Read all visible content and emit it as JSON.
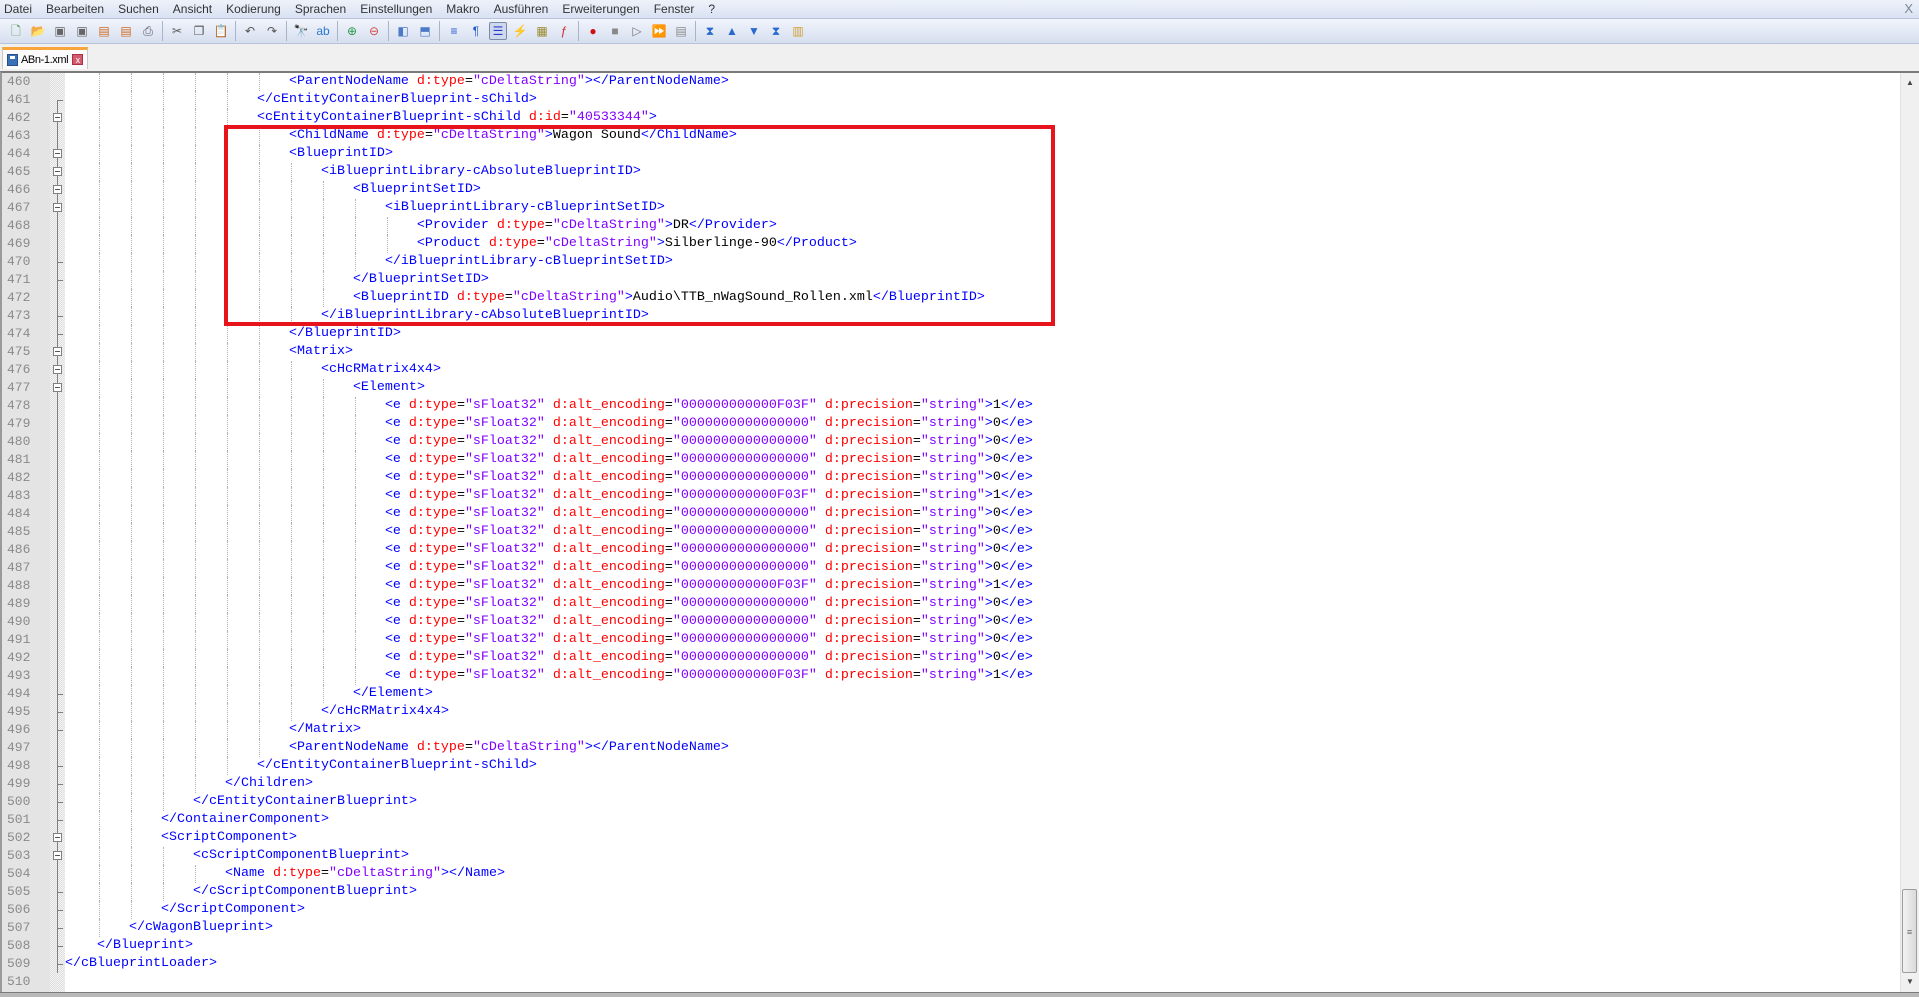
{
  "menu": [
    "Datei",
    "Bearbeiten",
    "Suchen",
    "Ansicht",
    "Kodierung",
    "Sprachen",
    "Einstellungen",
    "Makro",
    "Ausführen",
    "Erweiterungen",
    "Fenster",
    "?"
  ],
  "window_close": "X",
  "toolbar": [
    {
      "icon": "new-file-icon",
      "glyph": "🗋",
      "color": "#3a8a3a"
    },
    {
      "icon": "open-file-icon",
      "glyph": "📂",
      "color": "#d9a43a"
    },
    {
      "icon": "save-icon",
      "glyph": "▣",
      "color": "#666"
    },
    {
      "icon": "save-all-icon",
      "glyph": "▣",
      "color": "#666"
    },
    {
      "icon": "close-icon",
      "glyph": "▤",
      "color": "#d2691e"
    },
    {
      "icon": "close-all-icon",
      "glyph": "▤",
      "color": "#d2691e"
    },
    {
      "icon": "print-icon",
      "glyph": "⎙",
      "color": "#556"
    },
    {
      "sep": true
    },
    {
      "icon": "cut-icon",
      "glyph": "✂",
      "color": "#555"
    },
    {
      "icon": "copy-icon",
      "glyph": "❐",
      "color": "#555"
    },
    {
      "icon": "paste-icon",
      "glyph": "📋",
      "color": "#c8a04a"
    },
    {
      "sep": true
    },
    {
      "icon": "undo-icon",
      "glyph": "↶",
      "color": "#555"
    },
    {
      "icon": "redo-icon",
      "glyph": "↷",
      "color": "#555"
    },
    {
      "sep": true
    },
    {
      "icon": "find-icon",
      "glyph": "🔭",
      "color": "#333"
    },
    {
      "icon": "replace-icon",
      "glyph": "ab",
      "color": "#2a7ad0"
    },
    {
      "sep": true
    },
    {
      "icon": "zoom-in-icon",
      "glyph": "⊕",
      "color": "#2a9a4a"
    },
    {
      "icon": "zoom-out-icon",
      "glyph": "⊖",
      "color": "#d04a4a"
    },
    {
      "sep": true
    },
    {
      "icon": "sync-vertical-icon",
      "glyph": "◧",
      "color": "#4a7ac8"
    },
    {
      "icon": "sync-horizontal-icon",
      "glyph": "⬒",
      "color": "#4a7ac8"
    },
    {
      "sep": true
    },
    {
      "icon": "word-wrap-icon",
      "glyph": "≡",
      "color": "#2a5ad0"
    },
    {
      "icon": "show-all-characters-icon",
      "glyph": "¶",
      "color": "#2a5ad0"
    },
    {
      "icon": "indent-guide-icon",
      "glyph": "☰",
      "color": "#2a3ad0",
      "active": true
    },
    {
      "icon": "user-defined-language-icon",
      "glyph": "⚡",
      "color": "#e0a020"
    },
    {
      "icon": "document-map-icon",
      "glyph": "▦",
      "color": "#9a8a2a"
    },
    {
      "icon": "function-list-icon",
      "glyph": "ƒ",
      "color": "#d02a2a"
    },
    {
      "sep": true
    },
    {
      "icon": "record-macro-icon",
      "glyph": "●",
      "color": "#d01010"
    },
    {
      "icon": "stop-recording-icon",
      "glyph": "■",
      "color": "#888"
    },
    {
      "icon": "playback-macro-icon",
      "glyph": "▷",
      "color": "#777"
    },
    {
      "icon": "run-macro-multiple-icon",
      "glyph": "⏩",
      "color": "#3a6ad0"
    },
    {
      "icon": "save-macro-icon",
      "glyph": "▤",
      "color": "#888"
    },
    {
      "sep": true
    },
    {
      "icon": "first-icon",
      "glyph": "⧗",
      "color": "#2a6ad0"
    },
    {
      "icon": "previous-icon",
      "glyph": "▲",
      "color": "#2a6ad0"
    },
    {
      "icon": "next-icon",
      "glyph": "▼",
      "color": "#2a6ad0"
    },
    {
      "icon": "last-icon",
      "glyph": "⧗",
      "color": "#2a6ad0"
    },
    {
      "icon": "plugin-icon",
      "glyph": "▥",
      "color": "#d0a030"
    }
  ],
  "tab": {
    "label": "ABn-1.xml",
    "close": "x"
  },
  "colors": {
    "tag": "#0000ff",
    "attribute": "#ff0000",
    "value": "#8000ff",
    "text": "#000000",
    "highlight_box": "#e8141c",
    "active_tab_accent": "#f8a53b"
  },
  "editor": {
    "lines": [
      {
        "n": "460",
        "text": "                            <ParentNodeName d:type=\"cDeltaString\"></ParentNodeName>"
      },
      {
        "n": "461",
        "text": "                        </cEntityContainerBlueprint-sChild>",
        "fold": "end"
      },
      {
        "n": "462",
        "text": "                        <cEntityContainerBlueprint-sChild d:id=\"40533344\">",
        "fold": "box"
      },
      {
        "n": "463",
        "text": "                            <ChildName d:type=\"cDeltaString\">Wagon Sound</ChildName>"
      },
      {
        "n": "464",
        "text": "                            <BlueprintID>",
        "fold": "box"
      },
      {
        "n": "465",
        "text": "                                <iBlueprintLibrary-cAbsoluteBlueprintID>",
        "fold": "box"
      },
      {
        "n": "466",
        "text": "                                    <BlueprintSetID>",
        "fold": "box"
      },
      {
        "n": "467",
        "text": "                                        <iBlueprintLibrary-cBlueprintSetID>",
        "fold": "box"
      },
      {
        "n": "468",
        "text": "                                            <Provider d:type=\"cDeltaString\">DR</Provider>"
      },
      {
        "n": "469",
        "text": "                                            <Product d:type=\"cDeltaString\">Silberlinge-90</Product>"
      },
      {
        "n": "470",
        "text": "                                        </iBlueprintLibrary-cBlueprintSetID>",
        "fold": "end"
      },
      {
        "n": "471",
        "text": "                                    </BlueprintSetID>",
        "fold": "end"
      },
      {
        "n": "472",
        "text": "                                    <BlueprintID d:type=\"cDeltaString\">Audio\\TTB_nWagSound_Rollen.xml</BlueprintID>"
      },
      {
        "n": "473",
        "text": "                                </iBlueprintLibrary-cAbsoluteBlueprintID>",
        "fold": "end"
      },
      {
        "n": "474",
        "text": "                            </BlueprintID>",
        "fold": "end"
      },
      {
        "n": "475",
        "text": "                            <Matrix>",
        "fold": "box"
      },
      {
        "n": "476",
        "text": "                                <cHcRMatrix4x4>",
        "fold": "box"
      },
      {
        "n": "477",
        "text": "                                    <Element>",
        "fold": "box"
      },
      {
        "n": "478",
        "text": "                                        <e d:type=\"sFloat32\" d:alt_encoding=\"000000000000F03F\" d:precision=\"string\">1</e>"
      },
      {
        "n": "479",
        "text": "                                        <e d:type=\"sFloat32\" d:alt_encoding=\"0000000000000000\" d:precision=\"string\">0</e>"
      },
      {
        "n": "480",
        "text": "                                        <e d:type=\"sFloat32\" d:alt_encoding=\"0000000000000000\" d:precision=\"string\">0</e>"
      },
      {
        "n": "481",
        "text": "                                        <e d:type=\"sFloat32\" d:alt_encoding=\"0000000000000000\" d:precision=\"string\">0</e>"
      },
      {
        "n": "482",
        "text": "                                        <e d:type=\"sFloat32\" d:alt_encoding=\"0000000000000000\" d:precision=\"string\">0</e>"
      },
      {
        "n": "483",
        "text": "                                        <e d:type=\"sFloat32\" d:alt_encoding=\"000000000000F03F\" d:precision=\"string\">1</e>"
      },
      {
        "n": "484",
        "text": "                                        <e d:type=\"sFloat32\" d:alt_encoding=\"0000000000000000\" d:precision=\"string\">0</e>"
      },
      {
        "n": "485",
        "text": "                                        <e d:type=\"sFloat32\" d:alt_encoding=\"0000000000000000\" d:precision=\"string\">0</e>"
      },
      {
        "n": "486",
        "text": "                                        <e d:type=\"sFloat32\" d:alt_encoding=\"0000000000000000\" d:precision=\"string\">0</e>"
      },
      {
        "n": "487",
        "text": "                                        <e d:type=\"sFloat32\" d:alt_encoding=\"0000000000000000\" d:precision=\"string\">0</e>"
      },
      {
        "n": "488",
        "text": "                                        <e d:type=\"sFloat32\" d:alt_encoding=\"000000000000F03F\" d:precision=\"string\">1</e>"
      },
      {
        "n": "489",
        "text": "                                        <e d:type=\"sFloat32\" d:alt_encoding=\"0000000000000000\" d:precision=\"string\">0</e>"
      },
      {
        "n": "490",
        "text": "                                        <e d:type=\"sFloat32\" d:alt_encoding=\"0000000000000000\" d:precision=\"string\">0</e>"
      },
      {
        "n": "491",
        "text": "                                        <e d:type=\"sFloat32\" d:alt_encoding=\"0000000000000000\" d:precision=\"string\">0</e>"
      },
      {
        "n": "492",
        "text": "                                        <e d:type=\"sFloat32\" d:alt_encoding=\"0000000000000000\" d:precision=\"string\">0</e>"
      },
      {
        "n": "493",
        "text": "                                        <e d:type=\"sFloat32\" d:alt_encoding=\"000000000000F03F\" d:precision=\"string\">1</e>"
      },
      {
        "n": "494",
        "text": "                                    </Element>",
        "fold": "end"
      },
      {
        "n": "495",
        "text": "                                </cHcRMatrix4x4>",
        "fold": "end"
      },
      {
        "n": "496",
        "text": "                            </Matrix>",
        "fold": "end"
      },
      {
        "n": "497",
        "text": "                            <ParentNodeName d:type=\"cDeltaString\"></ParentNodeName>"
      },
      {
        "n": "498",
        "text": "                        </cEntityContainerBlueprint-sChild>",
        "fold": "end"
      },
      {
        "n": "499",
        "text": "                    </Children>",
        "fold": "end"
      },
      {
        "n": "500",
        "text": "                </cEntityContainerBlueprint>",
        "fold": "end"
      },
      {
        "n": "501",
        "text": "            </ContainerComponent>",
        "fold": "end"
      },
      {
        "n": "502",
        "text": "            <ScriptComponent>",
        "fold": "box"
      },
      {
        "n": "503",
        "text": "                <cScriptComponentBlueprint>",
        "fold": "box"
      },
      {
        "n": "504",
        "text": "                    <Name d:type=\"cDeltaString\"></Name>"
      },
      {
        "n": "505",
        "text": "                </cScriptComponentBlueprint>",
        "fold": "end"
      },
      {
        "n": "506",
        "text": "            </ScriptComponent>",
        "fold": "end"
      },
      {
        "n": "507",
        "text": "        </cWagonBlueprint>",
        "fold": "end"
      },
      {
        "n": "508",
        "text": "    </Blueprint>",
        "fold": "end"
      },
      {
        "n": "509",
        "text": "</cBlueprintLoader>",
        "fold": "end"
      },
      {
        "n": "510",
        "text": ""
      }
    ]
  },
  "highlight_box": {
    "from_line": "463",
    "to_line": "473"
  }
}
